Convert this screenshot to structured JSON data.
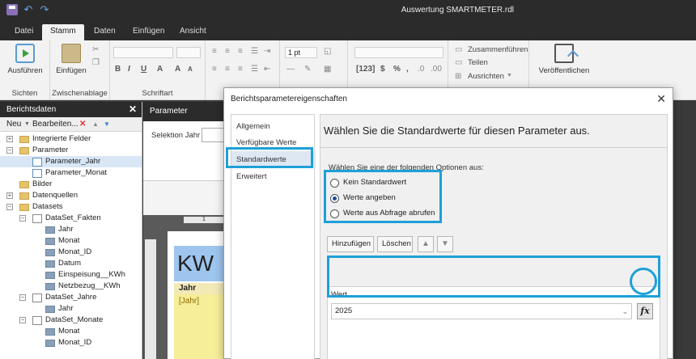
{
  "window": {
    "title": "Auswertung SMARTMETER.rdl"
  },
  "quick_access": {
    "save_icon": "save-icon",
    "undo_icon": "undo-icon",
    "redo_icon": "redo-icon"
  },
  "tabs": [
    {
      "label": "Datei"
    },
    {
      "label": "Stamm"
    },
    {
      "label": "Daten"
    },
    {
      "label": "Einfügen"
    },
    {
      "label": "Ansicht"
    }
  ],
  "ribbon": {
    "run_label": "Ausführen",
    "group_views": "Sichten",
    "paste_label": "Einfügen",
    "group_clipboard": "Zwischenablage",
    "group_font": "Schriftart",
    "font_size": "1 pt",
    "merge_label": "Zusammenführen",
    "split_label": "Teilen",
    "align_label": "Ausrichten",
    "publish_label": "Veröffentlichen",
    "bold": "B",
    "italic": "I",
    "underline": "U",
    "font_color": "A",
    "grow": "A",
    "shrink": "A"
  },
  "left_panel": {
    "title": "Berichtsdaten",
    "close": "✕",
    "new_label": "Neu",
    "edit_label": "Bearbeiten...",
    "delete_icon": "✕",
    "up_icon": "▲",
    "down_icon": "▼",
    "tree": [
      {
        "label": "Integrierte Felder",
        "level": 0,
        "type": "folder",
        "exp": "+"
      },
      {
        "label": "Parameter",
        "level": 0,
        "type": "folder",
        "exp": "−"
      },
      {
        "label": "Parameter_Jahr",
        "level": 1,
        "type": "param",
        "selected": true
      },
      {
        "label": "Parameter_Monat",
        "level": 1,
        "type": "param"
      },
      {
        "label": "Bilder",
        "level": 0,
        "type": "folder"
      },
      {
        "label": "Datenquellen",
        "level": 0,
        "type": "folder",
        "exp": "+"
      },
      {
        "label": "Datasets",
        "level": 0,
        "type": "folder",
        "exp": "−"
      },
      {
        "label": "DataSet_Fakten",
        "level": 1,
        "type": "dataset",
        "exp": "−"
      },
      {
        "label": "Jahr",
        "level": 2,
        "type": "field"
      },
      {
        "label": "Monat",
        "level": 2,
        "type": "field"
      },
      {
        "label": "Monat_ID",
        "level": 2,
        "type": "field"
      },
      {
        "label": "Datum",
        "level": 2,
        "type": "field"
      },
      {
        "label": "Einspeisung__KWh",
        "level": 2,
        "type": "field"
      },
      {
        "label": "Netzbezug__KWh",
        "level": 2,
        "type": "field"
      },
      {
        "label": "DataSet_Jahre",
        "level": 1,
        "type": "dataset",
        "exp": "−"
      },
      {
        "label": "Jahr",
        "level": 2,
        "type": "field"
      },
      {
        "label": "DataSet_Monate",
        "level": 1,
        "type": "dataset",
        "exp": "−"
      },
      {
        "label": "Monat",
        "level": 2,
        "type": "field"
      },
      {
        "label": "Monat_ID",
        "level": 2,
        "type": "field"
      }
    ]
  },
  "middle": {
    "header": "Parameter",
    "param_label": "Selektion Jahr",
    "ruler_mark": "1",
    "kwh_text": "KW",
    "jahr_header": "Jahr",
    "jahr_value": "[Jahr]"
  },
  "dialog": {
    "title": "Berichtsparametereigenschaften",
    "close": "✕",
    "nav": [
      {
        "label": "Allgemein"
      },
      {
        "label": "Verfügbare Werte"
      },
      {
        "label": "Standardwerte",
        "active": true
      },
      {
        "label": "Erweitert"
      }
    ],
    "heading": "Wählen Sie die Standardwerte für diesen Parameter aus.",
    "options_label": "Wählen Sie eine der folgenden Optionen aus:",
    "options": [
      {
        "label": "Kein Standardwert",
        "checked": false
      },
      {
        "label": "Werte angeben",
        "checked": true
      },
      {
        "label": "Werte aus Abfrage abrufen",
        "checked": false
      }
    ],
    "add_button": "Hinzufügen",
    "delete_button": "Löschen",
    "up_icon": "▲",
    "down_icon": "▼",
    "value_column": "Wert",
    "value": "2025",
    "fx": "fx",
    "highlight_color": "#1ea0d8"
  }
}
